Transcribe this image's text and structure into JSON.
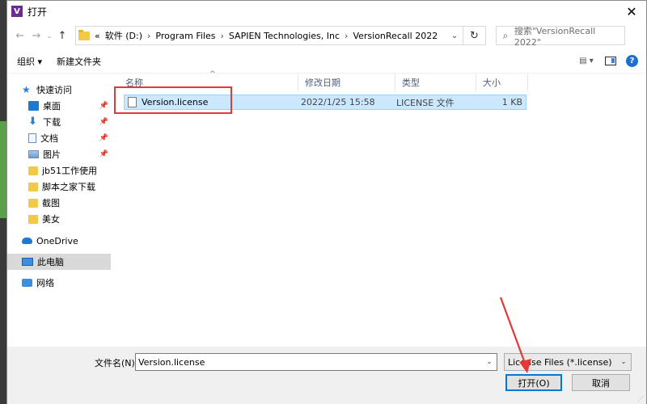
{
  "dialog": {
    "title": "打开",
    "app_icon_letter": "V"
  },
  "nav": {
    "back": "←",
    "forward": "→",
    "recent": "⌄",
    "up": "↑"
  },
  "address": {
    "overflow": "«",
    "crumbs": [
      "软件 (D:)",
      "Program Files",
      "SAPIEN Technologies, Inc",
      "VersionRecall 2022"
    ],
    "separator": "›",
    "refresh": "↻"
  },
  "search": {
    "placeholder": "搜索\"VersionRecall 2022\""
  },
  "toolbar": {
    "organize": "组织 ▾",
    "new_folder": "新建文件夹"
  },
  "sidebar": {
    "items": [
      {
        "label": "快速访问",
        "icon": "star-icon"
      },
      {
        "label": "桌面",
        "icon": "desktop-icon",
        "pinned": true
      },
      {
        "label": "下载",
        "icon": "download-icon",
        "pinned": true
      },
      {
        "label": "文档",
        "icon": "document-icon",
        "pinned": true
      },
      {
        "label": "图片",
        "icon": "pictures-icon",
        "pinned": true
      },
      {
        "label": "jb51工作使用",
        "icon": "folder-icon"
      },
      {
        "label": "脚本之家下载",
        "icon": "folder-icon"
      },
      {
        "label": "截图",
        "icon": "folder-icon"
      },
      {
        "label": "美女",
        "icon": "folder-icon"
      },
      {
        "label": "OneDrive",
        "icon": "cloud-icon"
      },
      {
        "label": "此电脑",
        "icon": "computer-icon"
      },
      {
        "label": "网络",
        "icon": "network-icon"
      }
    ]
  },
  "columns": {
    "name": "名称",
    "modified": "修改日期",
    "type": "类型",
    "size": "大小"
  },
  "files": [
    {
      "name": "Version.license",
      "modified": "2022/1/25 15:58",
      "type": "LICENSE 文件",
      "size": "1 KB"
    }
  ],
  "bottom": {
    "filename_label": "文件名(N):",
    "filename_value": "Version.license",
    "filetype_value": "License Files (*.license)",
    "open_label": "打开(O)",
    "cancel_label": "取消"
  },
  "colors": {
    "selection": "#cce8ff",
    "annotation": "#e53935",
    "accent": "#0078d7"
  }
}
